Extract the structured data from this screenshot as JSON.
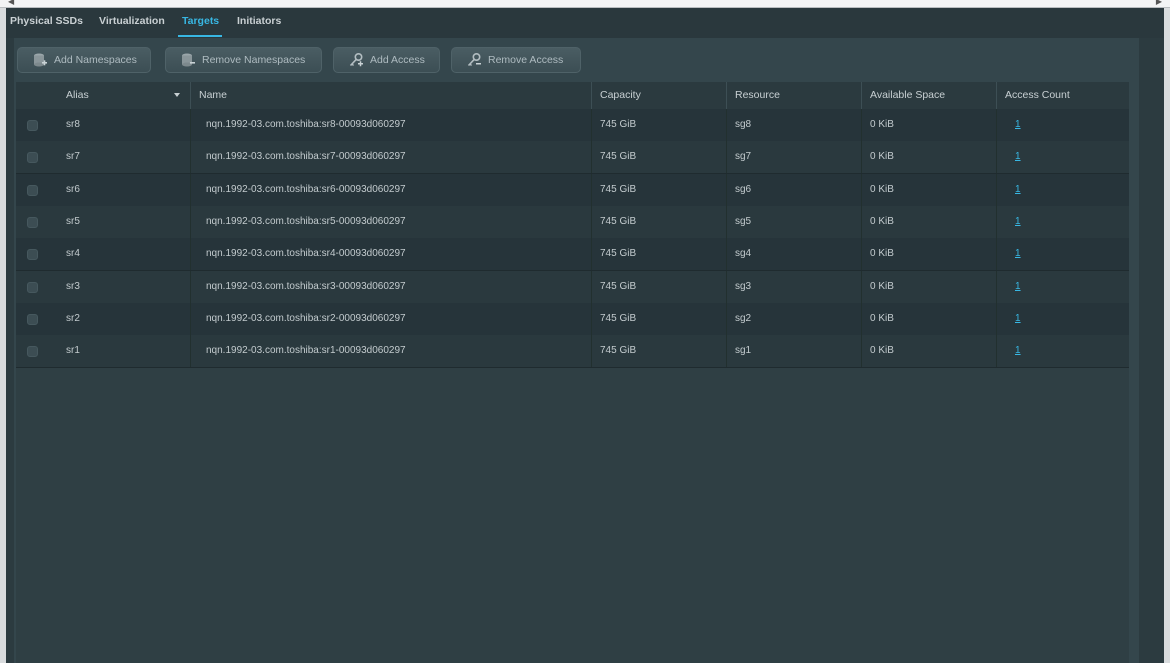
{
  "tabs": [
    {
      "label": "Physical SSDs",
      "active": false
    },
    {
      "label": "Virtualization",
      "active": false
    },
    {
      "label": "Targets",
      "active": true
    },
    {
      "label": "Initiators",
      "active": false
    }
  ],
  "toolbar": {
    "add_namespaces": "Add Namespaces",
    "remove_namespaces": "Remove Namespaces",
    "add_access": "Add Access",
    "remove_access": "Remove Access"
  },
  "table": {
    "columns": [
      "Alias",
      "Name",
      "Capacity",
      "Resource",
      "Available Space",
      "Access Count"
    ],
    "rows": [
      {
        "alias": "sr8",
        "name": "nqn.1992-03.com.toshiba:sr8-00093d060297",
        "capacity": "745 GiB",
        "resource": "sg8",
        "available": "0 KiB",
        "access_count": "1"
      },
      {
        "alias": "sr7",
        "name": "nqn.1992-03.com.toshiba:sr7-00093d060297",
        "capacity": "745 GiB",
        "resource": "sg7",
        "available": "0 KiB",
        "access_count": "1"
      },
      {
        "alias": "sr6",
        "name": "nqn.1992-03.com.toshiba:sr6-00093d060297",
        "capacity": "745 GiB",
        "resource": "sg6",
        "available": "0 KiB",
        "access_count": "1"
      },
      {
        "alias": "sr5",
        "name": "nqn.1992-03.com.toshiba:sr5-00093d060297",
        "capacity": "745 GiB",
        "resource": "sg5",
        "available": "0 KiB",
        "access_count": "1"
      },
      {
        "alias": "sr4",
        "name": "nqn.1992-03.com.toshiba:sr4-00093d060297",
        "capacity": "745 GiB",
        "resource": "sg4",
        "available": "0 KiB",
        "access_count": "1"
      },
      {
        "alias": "sr3",
        "name": "nqn.1992-03.com.toshiba:sr3-00093d060297",
        "capacity": "745 GiB",
        "resource": "sg3",
        "available": "0 KiB",
        "access_count": "1"
      },
      {
        "alias": "sr2",
        "name": "nqn.1992-03.com.toshiba:sr2-00093d060297",
        "capacity": "745 GiB",
        "resource": "sg2",
        "available": "0 KiB",
        "access_count": "1"
      },
      {
        "alias": "sr1",
        "name": "nqn.1992-03.com.toshiba:sr1-00093d060297",
        "capacity": "745 GiB",
        "resource": "sg1",
        "available": "0 KiB",
        "access_count": "1"
      }
    ]
  },
  "colors": {
    "accent": "#38b7e3",
    "background": "#34464c",
    "text": "#c3cbce"
  },
  "icons": {
    "add_namespaces": "database-add-icon",
    "remove_namespaces": "database-remove-icon",
    "add_access": "key-add-icon",
    "remove_access": "key-remove-icon",
    "sort": "chevron-down-icon"
  }
}
